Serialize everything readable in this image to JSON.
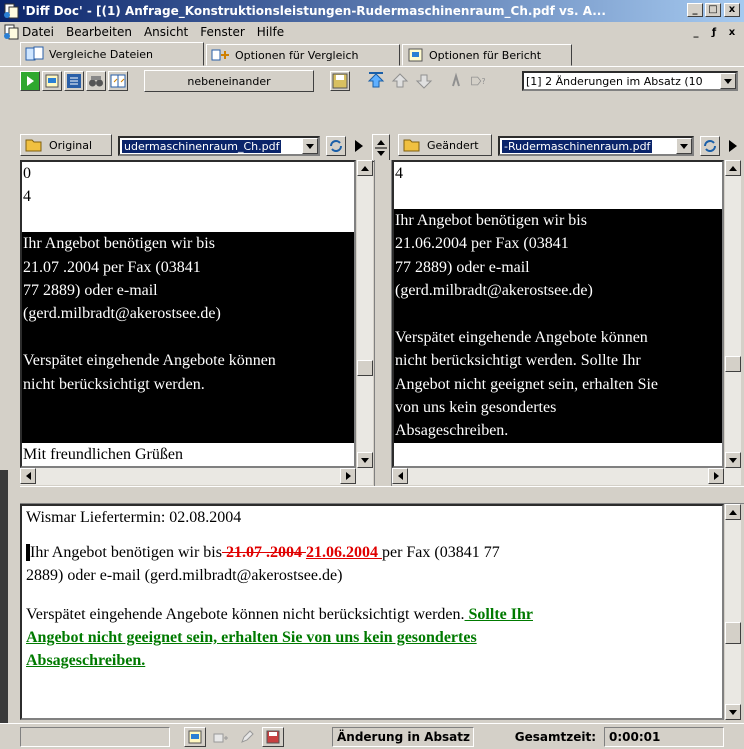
{
  "window": {
    "title": "'Diff Doc' - [(1) Anfrage_Konstruktionsleistungen-Rudermaschinenraum_Ch.pdf vs. A...",
    "controls": [
      "_",
      "□",
      "x"
    ],
    "mdi_controls": [
      "_",
      "ƒ",
      "x"
    ]
  },
  "menu": [
    "Datei",
    "Bearbeiten",
    "Ansicht",
    "Fenster",
    "Hilfe"
  ],
  "tabs": [
    {
      "label": "Vergleiche Dateien",
      "icon": "compare-files-icon",
      "active": true
    },
    {
      "label": "Optionen für Vergleich",
      "icon": "compare-options-icon",
      "active": false
    },
    {
      "label": "Optionen für Bericht",
      "icon": "report-options-icon",
      "active": false
    }
  ],
  "toolbar": {
    "view_mode_label": "nebeneinander",
    "change_combo": "[1] 2 Änderungen im Absatz (10",
    "icons": [
      "run-compare-icon",
      "report-icon",
      "list-icon",
      "binoculars-icon",
      "side-by-side-icon",
      "save-icon",
      "first-change-icon",
      "prev-change-icon",
      "next-change-icon",
      "last-change-icon",
      "jump-icon"
    ]
  },
  "original": {
    "button_label": "Original",
    "file": "udermaschinenraum_Ch.pdf",
    "lines": [
      {
        "text": "0",
        "hl": false
      },
      {
        "text": "4",
        "hl": false
      },
      {
        "text": "",
        "hl": false
      },
      {
        "text": "Ihr Angebot benötigen wir bis",
        "hl": true
      },
      {
        "text": "21.07 .2004 per Fax (03841",
        "hl": true
      },
      {
        "text": "77 2889) oder e-mail",
        "hl": true
      },
      {
        "text": "(gerd.milbradt@akerostsee.de)",
        "hl": true
      },
      {
        "text": "",
        "hl": true
      },
      {
        "text": "Verspätet eingehende Angebote können",
        "hl": true
      },
      {
        "text": "nicht berücksichtigt werden.",
        "hl": true
      },
      {
        "text": "",
        "hl": true
      },
      {
        "text": "",
        "hl": true
      },
      {
        "text": "Mit freundlichen Grüßen",
        "hl": false
      }
    ]
  },
  "changed": {
    "button_label": "Geändert",
    "file": "-Rudermaschinenraum.pdf",
    "lines": [
      {
        "text": "4",
        "hl": false
      },
      {
        "text": "",
        "hl": false
      },
      {
        "text": "Ihr Angebot benötigen wir bis",
        "hl": true
      },
      {
        "text": "21.06.2004 per Fax (03841",
        "hl": true
      },
      {
        "text": "77 2889) oder e-mail",
        "hl": true
      },
      {
        "text": "(gerd.milbradt@akerostsee.de)",
        "hl": true
      },
      {
        "text": "",
        "hl": true
      },
      {
        "text": "Verspätet eingehende Angebote können",
        "hl": true
      },
      {
        "text": "nicht berücksichtigt werden. Sollte Ihr",
        "hl": true
      },
      {
        "text": "Angebot nicht geeignet sein, erhalten Sie",
        "hl": true
      },
      {
        "text": "von uns kein gesondertes",
        "hl": true
      },
      {
        "text": "Absageschreiben.",
        "hl": true
      }
    ]
  },
  "report": {
    "line1": "Wismar Liefertermin: 02.08.2004",
    "p2_a": "Ihr Angebot benötigen wir bis",
    "p2_del": " 21.07 .2004 ",
    "p2_ins": "21.06.2004 ",
    "p2_b": "per Fax (03841 77",
    "p2_line2": "2889) oder e-mail (gerd.milbradt@akerostsee.de)",
    "p3_a": "Verspätet eingehende Angebote können nicht berücksichtigt werden.",
    "p3_add1": " Sollte Ihr",
    "p3_add2": "Angebot nicht geeignet sein, erhalten Sie von uns kein gesondertes",
    "p3_add3": "Absageschreiben."
  },
  "status": {
    "change_label": "Änderung in Absatz",
    "total_time_label": "Gesamtzeit:",
    "total_time": "0:00:01"
  },
  "colors": {
    "title_start": "#0a246a",
    "title_end": "#a6caf0",
    "deleted": "#e00000",
    "added": "#007a00"
  }
}
